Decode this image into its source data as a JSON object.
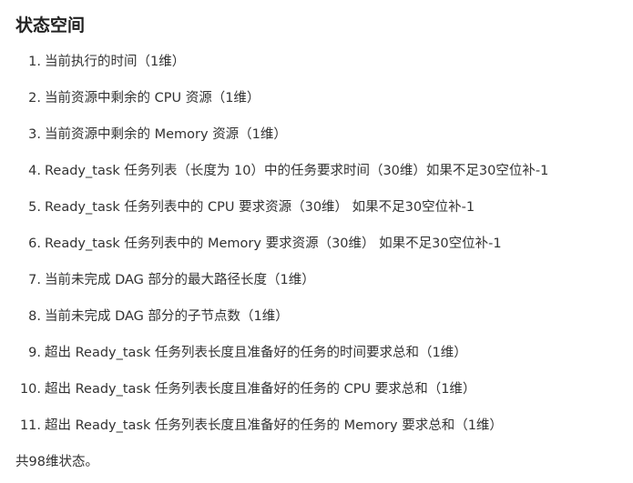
{
  "heading": "状态空间",
  "items": [
    {
      "num": "1.",
      "text": "当前执行的时间（1维）"
    },
    {
      "num": "2.",
      "text": "当前资源中剩余的 CPU 资源（1维）"
    },
    {
      "num": "3.",
      "text": "当前资源中剩余的 Memory 资源（1维）"
    },
    {
      "num": "4.",
      "text": "Ready_task 任务列表（长度为 10）中的任务要求时间（30维）如果不足30空位补-1"
    },
    {
      "num": "5.",
      "text": "Ready_task 任务列表中的 CPU 要求资源（30维） 如果不足30空位补-1"
    },
    {
      "num": "6.",
      "text": "Ready_task 任务列表中的 Memory 要求资源（30维） 如果不足30空位补-1"
    },
    {
      "num": "7.",
      "text": "当前未完成 DAG 部分的最大路径长度（1维）"
    },
    {
      "num": "8.",
      "text": "当前未完成 DAG 部分的子节点数（1维）"
    },
    {
      "num": "9.",
      "text": "超出 Ready_task 任务列表长度且准备好的任务的时间要求总和（1维）"
    },
    {
      "num": "10.",
      "text": "超出 Ready_task 任务列表长度且准备好的任务的 CPU 要求总和（1维）"
    },
    {
      "num": "11.",
      "text": "超出 Ready_task 任务列表长度且准备好的任务的 Memory 要求总和（1维）"
    }
  ],
  "footer": "共98维状态。"
}
